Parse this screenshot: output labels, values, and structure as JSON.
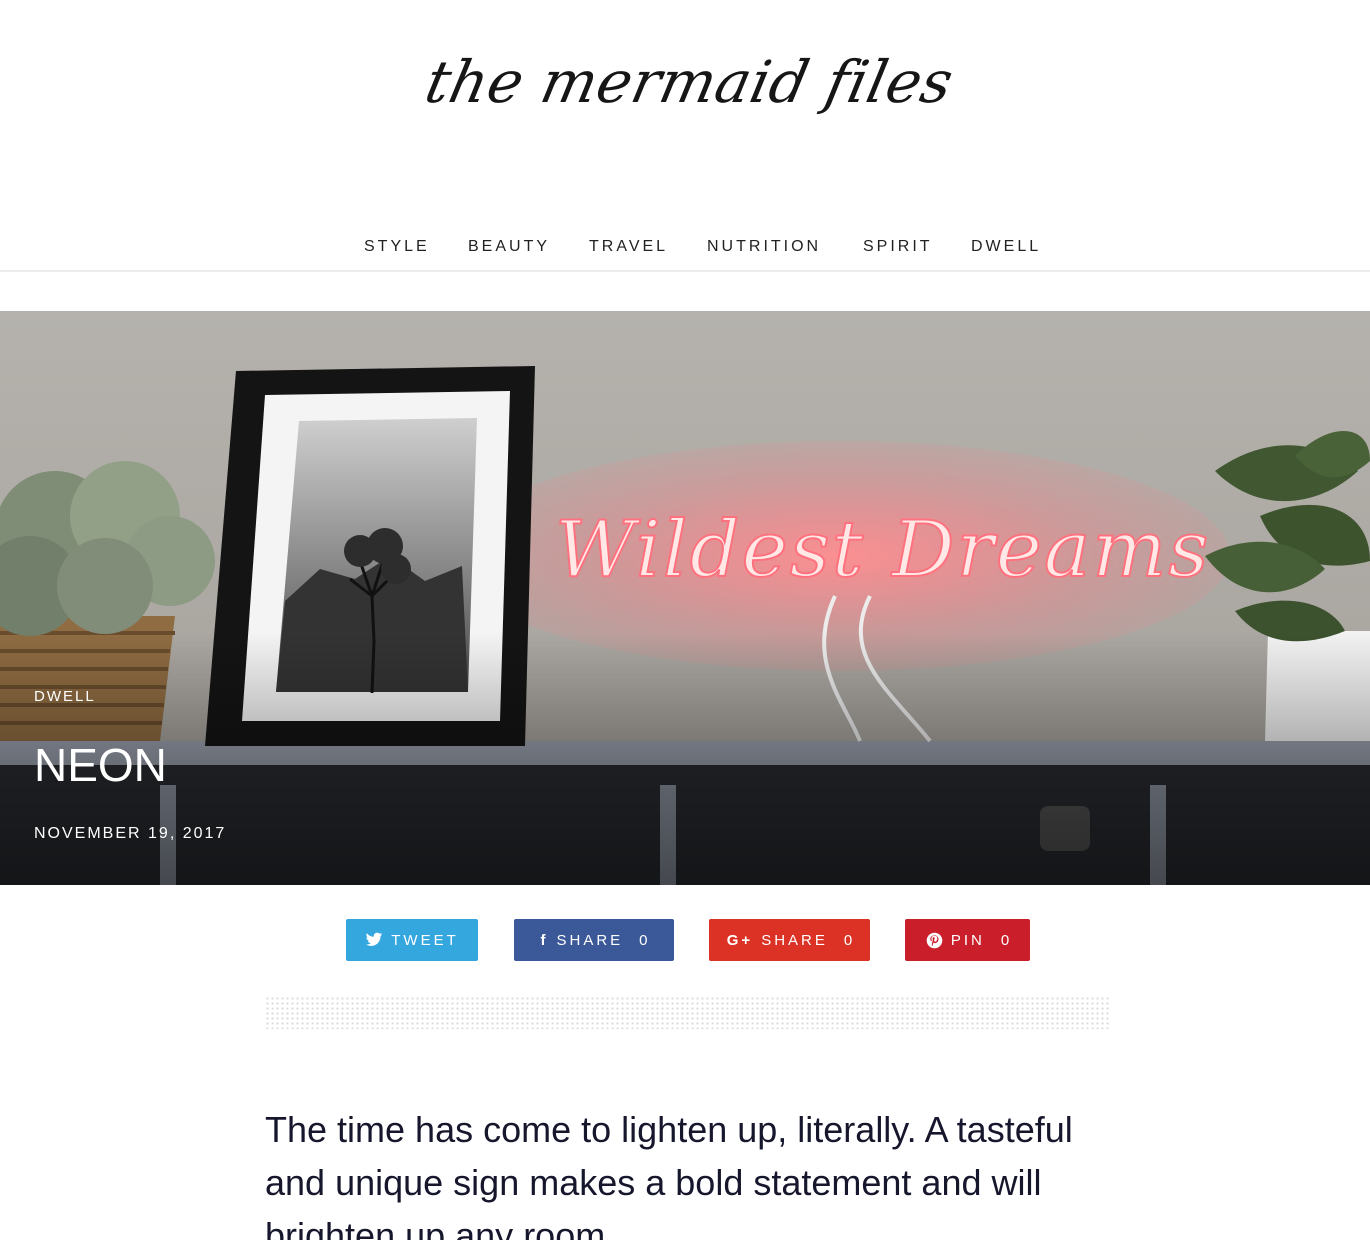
{
  "site": {
    "title": "the mermaid files"
  },
  "navigation": {
    "items": [
      {
        "label": "STYLE"
      },
      {
        "label": "BEAUTY"
      },
      {
        "label": "TRAVEL"
      },
      {
        "label": "NUTRITION"
      },
      {
        "label": "SPIRIT"
      },
      {
        "label": "DWELL"
      }
    ]
  },
  "hero": {
    "category": "DWELL",
    "title": "NEON",
    "date": "NOVEMBER 19, 2017",
    "image_text": "Wildest Dreams"
  },
  "share": {
    "twitter": {
      "label": "TWEET"
    },
    "facebook": {
      "label": "SHARE",
      "count": "0"
    },
    "google": {
      "label": "SHARE",
      "count": "0"
    },
    "pinterest": {
      "label": "PIN",
      "count": "0"
    }
  },
  "article": {
    "intro": "The time has come to lighten up, literally. A tasteful and unique sign makes a bold statement and will brighten up any room."
  },
  "colors": {
    "twitter": "#35a7df",
    "facebook": "#3b5998",
    "google": "#dc3125",
    "pinterest": "#ca1f2a",
    "neon": "#ff6f7f"
  }
}
